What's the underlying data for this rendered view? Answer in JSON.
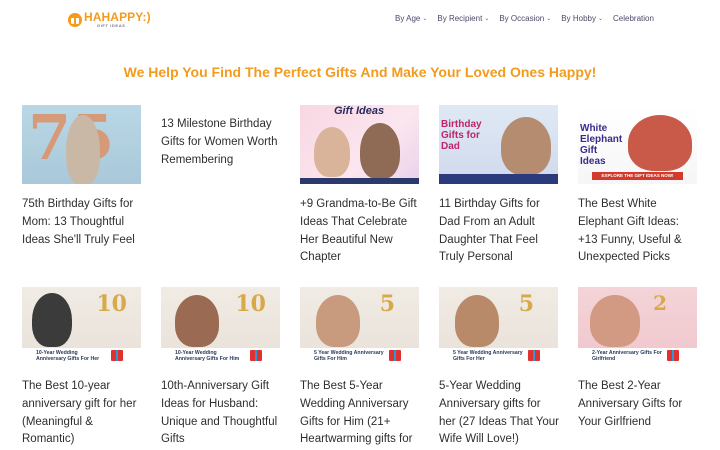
{
  "header": {
    "logo_text": "HAHAPPY:)",
    "logo_sub": "GIFT IDEAS",
    "nav": [
      {
        "label": "By Age",
        "has_dropdown": true
      },
      {
        "label": "By Recipient",
        "has_dropdown": true
      },
      {
        "label": "By Occasion",
        "has_dropdown": true
      },
      {
        "label": "By Hobby",
        "has_dropdown": true
      },
      {
        "label": "Celebration",
        "has_dropdown": false
      }
    ]
  },
  "headline": "We Help You Find The Perfect Gifts And Make Your Loved Ones Happy!",
  "cards": [
    {
      "title": "75th Birthday Gifts for Mom: 13 Thoughtful Ideas She'll Truly Feel",
      "image_text": "75"
    },
    {
      "title": "13 Milestone Birthday Gifts for Women Worth Remembering"
    },
    {
      "title": "+9 Grandma-to-Be Gift Ideas That Celebrate Her Beautiful New Chapter",
      "image_text": "Gift Ideas"
    },
    {
      "title": "11 Birthday Gifts for Dad From an Adult Daughter That Feel Truly Personal",
      "image_text": "Birthday Gifts for Dad"
    },
    {
      "title": "The Best White Elephant Gift Ideas: +13 Funny, Useful & Unexpected Picks",
      "image_text": "White Elephant Gift Ideas",
      "image_cta": "EXPLORE THE GIFT IDEAS NOW!"
    },
    {
      "title": "The Best 10-year anniversary gift for her (Meaningful & Romantic)",
      "image_text": "10-Year Wedding Anniversary Gifts For Her",
      "image_num": "10"
    },
    {
      "title": "10th-Anniversary Gift Ideas for Husband: Unique and Thoughtful Gifts",
      "image_text": "10-Year Wedding Anniversary Gifts For Him",
      "image_num": "10"
    },
    {
      "title": "The Best 5-Year Wedding Anniversary Gifts for Him (21+ Heartwarming gifts for",
      "image_text": "5 Year Wedding Anniversary Gifts For Him",
      "image_num": "5"
    },
    {
      "title": "5-Year Wedding Anniversary gifts for her (27 Ideas That Your Wife Will Love!)",
      "image_text": "5 Year Wedding Anniversary Gifts For Her",
      "image_num": "5"
    },
    {
      "title": "The Best 2-Year Anniversary Gifts for Your Girlfriend",
      "image_text": "2-Year Anniversary Gifts For Girlfriend",
      "image_num": "2"
    }
  ],
  "colors": {
    "brand_orange": "#f29b1d",
    "nav_text": "#4a4a6a",
    "title_text": "#2e2e2e"
  }
}
